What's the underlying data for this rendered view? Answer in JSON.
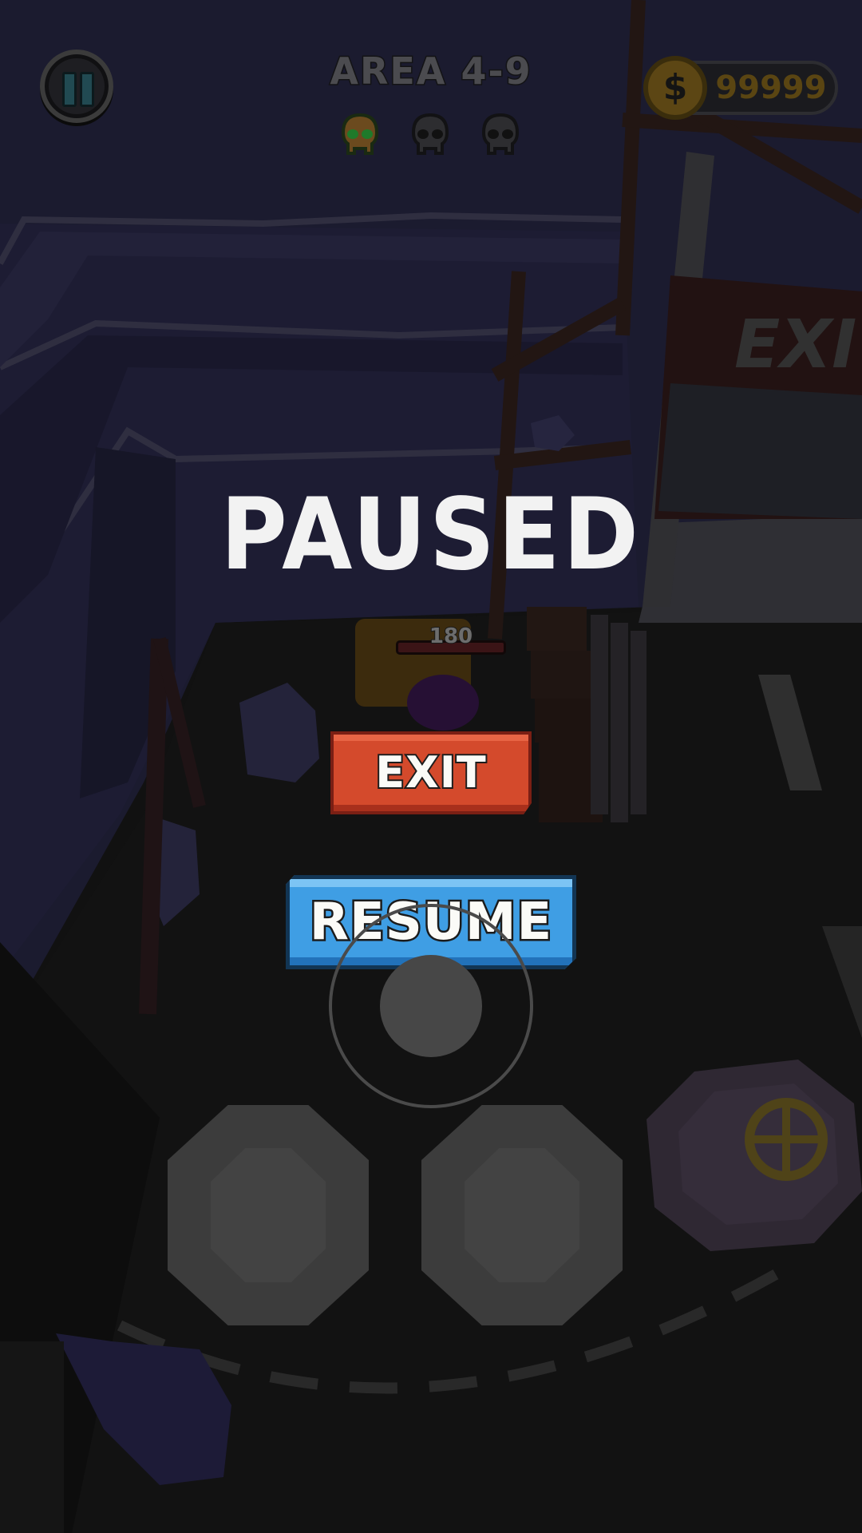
{
  "hud": {
    "area_title": "AREA 4-9",
    "skulls": [
      {
        "icon": "skull-icon",
        "state": "earned",
        "color": "#6b4a1e",
        "eye_color": "#1f7a2a"
      },
      {
        "icon": "skull-icon",
        "state": "locked",
        "color": "#2d2d30"
      },
      {
        "icon": "skull-icon",
        "state": "locked",
        "color": "#2d2d30"
      }
    ],
    "coin_icon_symbol": "$",
    "coins": "99999"
  },
  "pause_menu": {
    "title": "PAUSED",
    "exit_label": "EXIT",
    "resume_label": "RESUME"
  },
  "world": {
    "sign_text": "EXI",
    "player_health": "180"
  },
  "colors": {
    "exit_button": "#d44a2c",
    "resume_button": "#3f9ee4",
    "background": "#151515",
    "water": "#22213a"
  }
}
